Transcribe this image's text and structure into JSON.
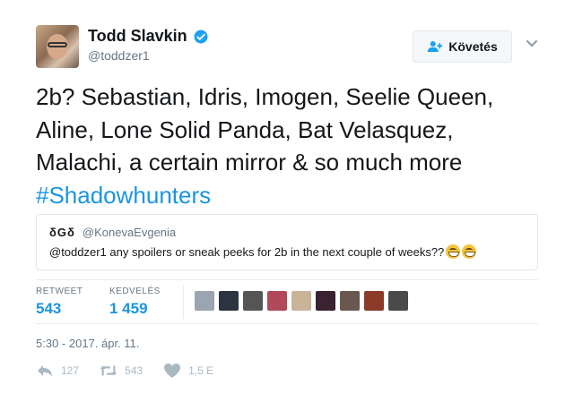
{
  "author": {
    "name": "Todd Slavkin",
    "handle": "@toddzer1",
    "verified_icon": "verified-badge-icon"
  },
  "follow_button": {
    "label": "Követés",
    "icon": "add-user-icon"
  },
  "tweet": {
    "text_lines": [
      "2b? Sebastian, Idris, Imogen, Seelie Queen,",
      "Aline, Lone Solid Panda, Bat Velasquez,",
      "Malachi, a certain mirror & so much more"
    ],
    "hashtag": "#Shadowhunters"
  },
  "quoted_tweet": {
    "name": "δGδ",
    "handle": "@KonevaEvgenia",
    "text": "@toddzer1 any spoilers or sneak peeks for 2b in the next couple of weeks??",
    "emojis": [
      "grinning-face-icon",
      "grinning-face-icon"
    ]
  },
  "stats": {
    "retweets_label": "RETWEET",
    "retweets_value": "543",
    "likes_label": "KEDVELÉS",
    "likes_value": "1 459"
  },
  "likers_colors": [
    "#9aa5b1",
    "#2b3440",
    "#555555",
    "#b04a5a",
    "#c9b49a",
    "#3a2230",
    "#6a5850",
    "#8c3a2a",
    "#4a4a4a"
  ],
  "timestamp": "5:30 - 2017. ápr. 11.",
  "actions": {
    "reply_count": "127",
    "retweet_count": "543",
    "like_count": "1,5 E"
  },
  "colors": {
    "link": "#1b95e0",
    "muted": "#657786",
    "action": "#aab8c2"
  }
}
